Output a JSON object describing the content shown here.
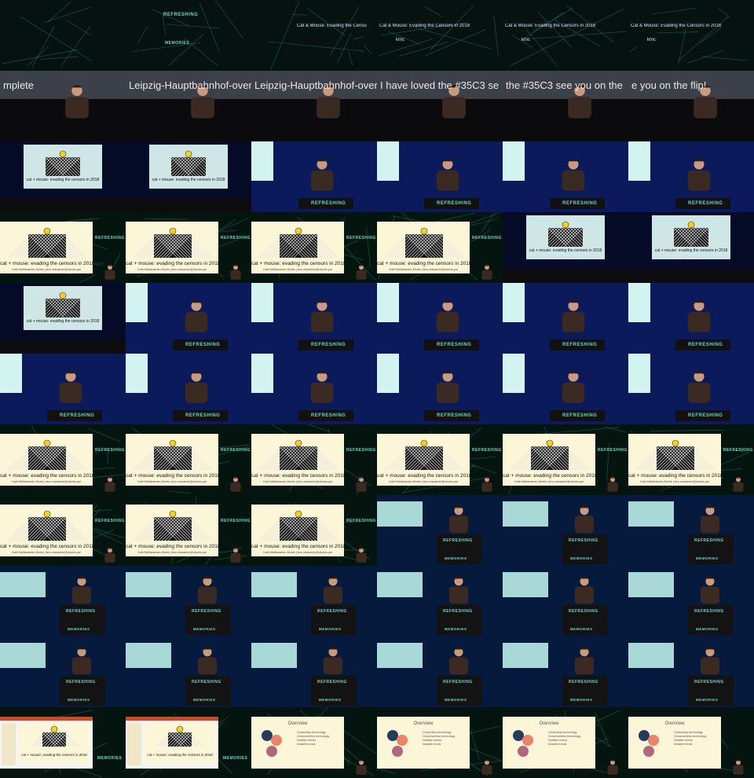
{
  "grid": {
    "cols": 6,
    "rows": 11
  },
  "branding": {
    "refreshing": "REFRESHING",
    "memories": "MEMORIES"
  },
  "lower_third": {
    "title": "Cat & Mouse: Evading the Censo",
    "title_full": "Cat & Mouse: Evading the Censors in 2018",
    "code": "kmc"
  },
  "marquee": {
    "complete": "mplete",
    "station": "Leipzig-Hauptbahnhof-overv",
    "farewell_a": "I have loved the #35C3 se",
    "farewell_b": "the #35C3 see you on the",
    "farewell_c": "e you on the",
    "farewell_d": "e you on the flip!"
  },
  "slide": {
    "title": "cat + mouse: evading the censors in 2018",
    "author": "Kath McManamen-Morris | kmc.manamen@ubuntu.pal",
    "corner": "Kath McManamen"
  },
  "podium": {
    "label": "REFRESHING"
  },
  "overview": {
    "title": "Overview",
    "items": [
      "Censorship technology",
      "Circumvention technology",
      "Notable events",
      "Notable trends"
    ]
  },
  "colors": {
    "teal": "#6fd6c7",
    "cream": "#fbf6d8",
    "navy": "#263a5c",
    "salmon": "#ea8466",
    "mauve": "#b2667e",
    "stage_blue": "#0a1a5a"
  },
  "frames": [
    "intro",
    "speaker-left-a",
    "speaker-left-b",
    "speaker-left-c",
    "speaker-left-d",
    "speaker-left-e",
    "hall-wide",
    "hall-wide",
    "podium",
    "podium",
    "podium",
    "podium",
    "slide-pip",
    "slide-pip",
    "slide-pip",
    "slide-pip",
    "hall-wide",
    "hall-wide",
    "hall-wide",
    "podium",
    "podium",
    "podium",
    "podium",
    "podium",
    "podium-left",
    "podium-left",
    "podium-left",
    "podium-left",
    "podium-left",
    "podium-left",
    "slide-pip",
    "slide-pip",
    "slide-pip",
    "slide-pip",
    "slide-pip",
    "slide-pip",
    "slide-pip",
    "slide-pip",
    "slide-pip",
    "speaker-bg",
    "speaker-bg",
    "speaker-bg",
    "speaker-bg",
    "speaker-bg",
    "speaker-bg",
    "speaker-bg",
    "speaker-bg",
    "speaker-bg",
    "speaker-bg",
    "speaker-bg",
    "speaker-bg",
    "speaker-bg",
    "speaker-bg",
    "speaker-bg",
    "ppt-pip",
    "ppt-pip",
    "overview-pip",
    "overview-pip",
    "overview-pip",
    "overview-pip"
  ]
}
